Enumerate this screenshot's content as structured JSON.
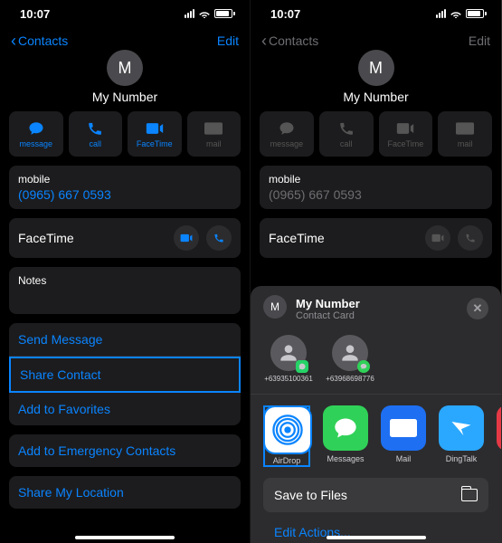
{
  "status": {
    "time": "10:07"
  },
  "nav": {
    "back": "Contacts",
    "edit": "Edit"
  },
  "contact": {
    "initial": "M",
    "name": "My Number"
  },
  "quick": {
    "message": "message",
    "call": "call",
    "facetime": "FaceTime",
    "mail": "mail"
  },
  "mobile": {
    "label": "mobile",
    "value": "(0965) 667 0593"
  },
  "facetime": {
    "label": "FaceTime"
  },
  "notes": {
    "label": "Notes"
  },
  "actions": {
    "send": "Send Message",
    "share": "Share Contact",
    "fav": "Add to Favorites",
    "emergency": "Add to Emergency Contacts",
    "loc": "Share My Location"
  },
  "sheet": {
    "title": "My Number",
    "subtitle": "Contact Card",
    "close": "✕",
    "sug1": "+63935100361",
    "sug2": "+63968698776",
    "apps": {
      "airdrop": "AirDrop",
      "messages": "Messages",
      "mail": "Mail",
      "ding": "DingTalk"
    },
    "save": "Save to Files",
    "edit_actions": "Edit Actions..."
  }
}
